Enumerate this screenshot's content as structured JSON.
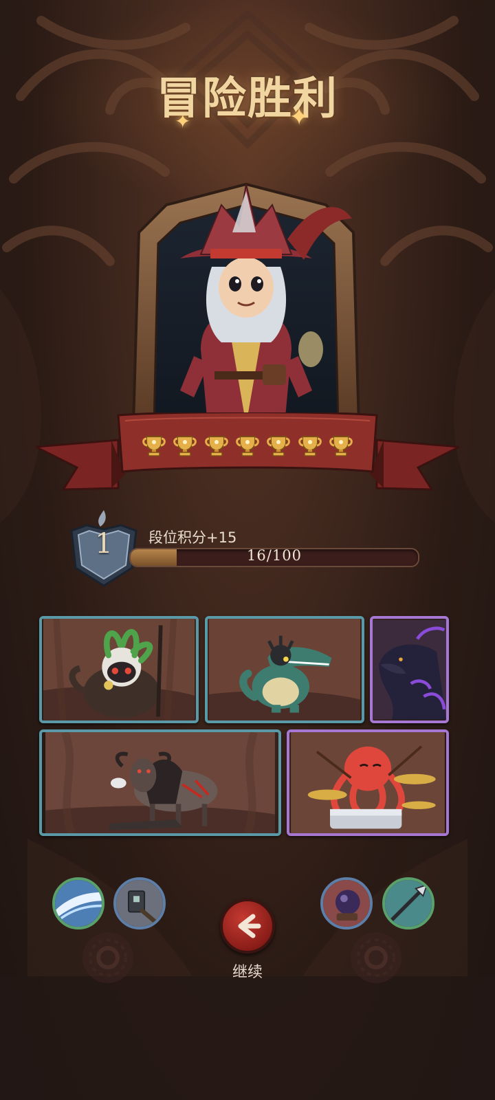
{
  "title": "冒险胜利",
  "rank": {
    "level": "1",
    "label": "段位积分+15",
    "progress_text": "16/100",
    "progress_fraction": 0.16
  },
  "trophy_count": 7,
  "portrait": {
    "character": "pirate-captain"
  },
  "enemies": [
    {
      "id": "tribal-bird-shaman",
      "rarity": "blue"
    },
    {
      "id": "spiked-crocodile",
      "rarity": "blue"
    },
    {
      "id": "shadow-dragon",
      "rarity": "purple"
    },
    {
      "id": "gnu-beast",
      "rarity": "blue"
    },
    {
      "id": "octopus-drummer",
      "rarity": "purple"
    }
  ],
  "items": [
    {
      "icon": "ice-slash-icon",
      "border": "#5aa06a"
    },
    {
      "icon": "hammer-icon",
      "border": "#5d7ea7"
    },
    {
      "icon": "orb-icon",
      "border": "#5d7ea7"
    },
    {
      "icon": "spear-icon",
      "border": "#5aa06a"
    }
  ],
  "continue": {
    "label": "继续"
  },
  "colors": {
    "accent_gold": "#f1d6a1",
    "ribbon_red": "#8e2f2a",
    "blue_border": "#5a9aa8",
    "purple_border": "#a678d4",
    "continue_red": "#c53a32"
  }
}
